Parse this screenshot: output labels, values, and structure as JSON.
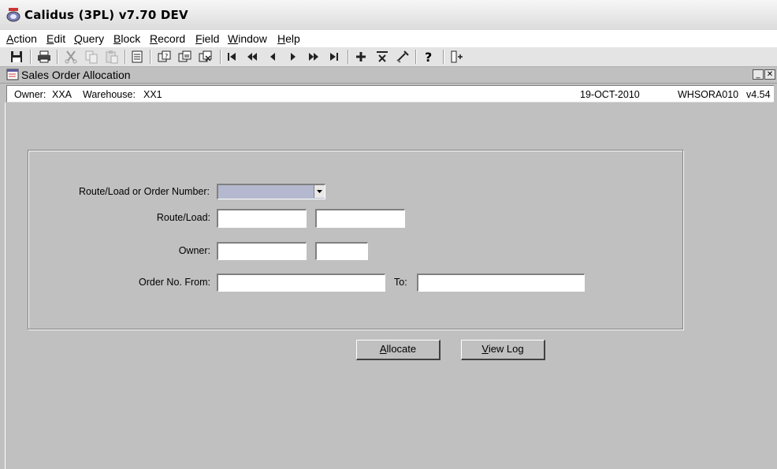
{
  "app": {
    "title": "Calidus (3PL) v7.70 DEV"
  },
  "menu": [
    {
      "label": "Action"
    },
    {
      "label": "Edit"
    },
    {
      "label": "Query"
    },
    {
      "label": "Block"
    },
    {
      "label": "Record"
    },
    {
      "label": "Field"
    },
    {
      "label": "Window"
    },
    {
      "label": "Help"
    }
  ],
  "toolbar_icons": [
    "save-icon",
    "print-icon",
    "cut-icon",
    "copy-icon",
    "paste-icon",
    "list-icon",
    "enter-query-icon",
    "execute-query-icon",
    "cancel-query-icon",
    "first-record-icon",
    "previous-block-icon",
    "previous-record-icon",
    "next-record-icon",
    "next-block-icon",
    "last-record-icon",
    "insert-record-icon",
    "delete-record-icon",
    "clear-record-icon",
    "help-icon",
    "exit-icon"
  ],
  "subwindow": {
    "title": "Sales Order Allocation"
  },
  "info": {
    "owner_label": "Owner:",
    "owner_value": "XXA",
    "warehouse_label": "Warehouse:",
    "warehouse_value": "XX1",
    "date": "19-OCT-2010",
    "module": "WHSORA010",
    "version": "v4.54"
  },
  "form": {
    "route_or_order_label": "Route/Load or Order Number:",
    "route_or_order_value": "",
    "route_load_label": "Route/Load:",
    "route_load_value_1": "",
    "route_load_value_2": "",
    "owner_label": "Owner:",
    "owner_value_1": "",
    "owner_value_2": "",
    "order_from_label": "Order No. From:",
    "order_from_value": "",
    "order_to_label": "To:",
    "order_to_value": ""
  },
  "buttons": {
    "allocate": "Allocate",
    "view_log": "View Log"
  }
}
